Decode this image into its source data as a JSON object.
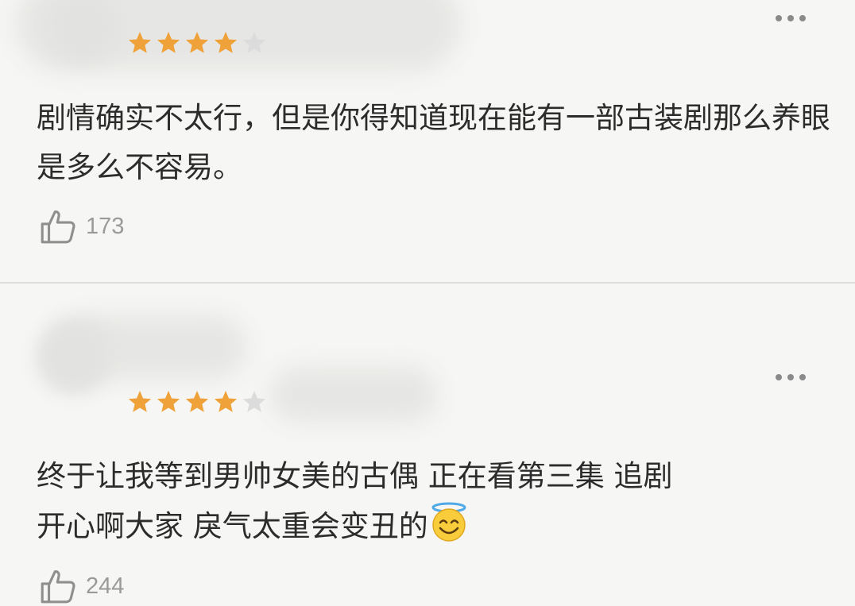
{
  "reviews": [
    {
      "rating": 4,
      "max_rating": 5,
      "text": "剧情确实不太行，但是你得知道现在能有一部古装剧那么养眼是多么不容易。",
      "likes": "173",
      "icons": {
        "like": "thumbs-up-icon",
        "more": "more-dots-icon"
      }
    },
    {
      "rating": 4,
      "max_rating": 5,
      "text_line1": "终于让我等到男帅女美的古偶 正在看第三集 追剧",
      "text_line2": "开心啊大家 戾气太重会变丑的",
      "emoji": "smiling-face-with-halo",
      "likes": "244",
      "icons": {
        "like": "thumbs-up-icon",
        "more": "more-dots-icon"
      }
    }
  ],
  "colors": {
    "star_filled": "#f0a23a",
    "star_empty": "#dcdcdc",
    "text": "#2c2c2c",
    "meta": "#9a9a9a"
  }
}
